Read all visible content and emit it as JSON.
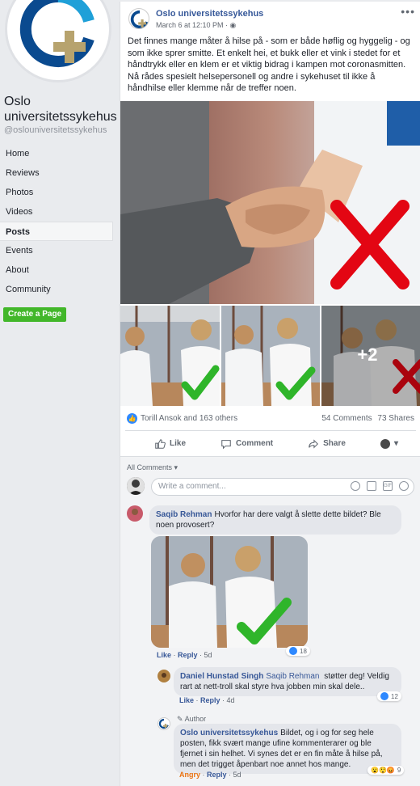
{
  "sidebar": {
    "page_name": "Oslo universitetssykehus",
    "handle": "@oslouniversitetssykehus",
    "nav": [
      {
        "label": "Home",
        "active": false
      },
      {
        "label": "Reviews",
        "active": false
      },
      {
        "label": "Photos",
        "active": false
      },
      {
        "label": "Videos",
        "active": false
      },
      {
        "label": "Posts",
        "active": true
      },
      {
        "label": "Events",
        "active": false
      },
      {
        "label": "About",
        "active": false
      },
      {
        "label": "Community",
        "active": false
      }
    ],
    "create_page": "Create a Page"
  },
  "post": {
    "author": "Oslo universitetssykehus",
    "date": "March 6 at 12:10 PM · ",
    "text": "Det finnes mange måter å hilse på - som er både høflig og hyggelig - og som ikke sprer smitte. Et enkelt hei, et bukk eller et vink i stedet for et håndtrykk eller en klem er et viktig bidrag i kampen mot coronasmitten. Nå rådes spesielt helsepersonell og andre i sykehuset til ikke å håndhilse eller klemme når de treffer noen.",
    "more_photos": "+2",
    "reactions_text": "Torill Ansok and 163 others",
    "comments_count": "54 Comments",
    "shares_count": "73 Shares",
    "actions": {
      "like": "Like",
      "comment": "Comment",
      "share": "Share"
    }
  },
  "comments_section": {
    "filter_label": "All Comments",
    "write_placeholder": "Write a comment...",
    "comments": [
      {
        "name": "Saqib Rehman",
        "text": "Hvorfor har dere valgt å slette dette bildet? Ble noen provosert?",
        "like": "Like",
        "reply": "Reply",
        "time": "5d",
        "reaction_count": "18"
      },
      {
        "name": "Daniel Hunstad Singh",
        "mention": "Saqib Rehman",
        "text": "støtter deg! Veldig rart at nett-troll skal styre hva jobben min skal dele..",
        "like": "Like",
        "reply": "Reply",
        "time": "4d",
        "reaction_count": "12"
      },
      {
        "tag": "Author",
        "name": "Oslo universitetssykehus",
        "text": "Bildet, og i og for seg hele posten, fikk svært mange ufine kommenterarer og ble fjernet i sin helhet. Vi synes det er en fin måte å hilse på, men det trigget åpenbart noe annet hos mange.",
        "angry": "Angry",
        "reply": "Reply",
        "time": "5d",
        "reaction_count": "9"
      }
    ]
  },
  "colors": {
    "brand_blue": "#365899",
    "green_button": "#42b72a",
    "like_blue": "#2d88ff",
    "angry_orange": "#e9710f",
    "cross_red": "#e30613",
    "check_green": "#2fb52a"
  }
}
